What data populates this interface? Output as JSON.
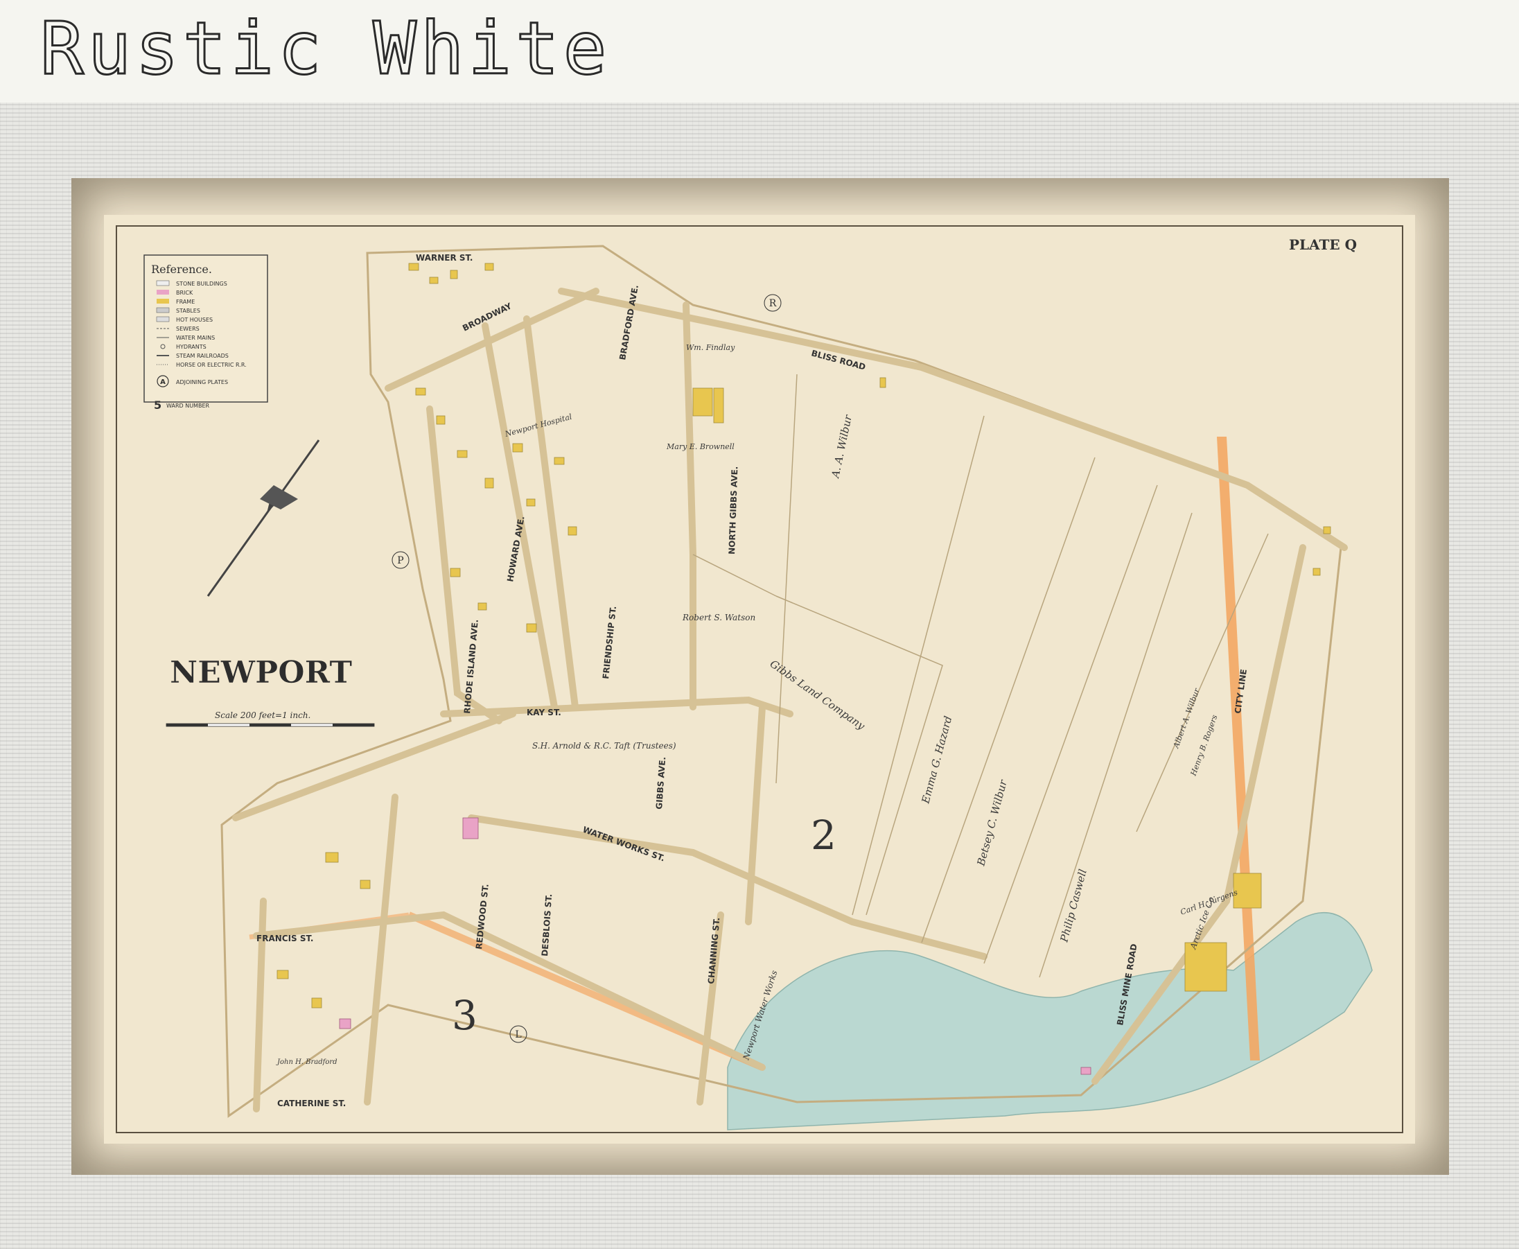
{
  "page": {
    "title": "Rustic White"
  },
  "map": {
    "plate_label": "PLATE Q",
    "city_label": "NEWPORT",
    "scale_text": "Scale 200 feet=1 inch.",
    "reference": {
      "title": "Reference.",
      "items": [
        "STONE BUILDINGS",
        "BRICK",
        "FRAME",
        "STABLES",
        "HOT HOUSES",
        "SEWERS",
        "WATER MAINS",
        "HYDRANTS",
        "STEAM RAILROADS",
        "HORSE OR ELECTRIC R.R.",
        "ADJOINING PLATES",
        "WARD NUMBER"
      ],
      "ward_sample": "5",
      "plate_sample": "A"
    },
    "streets": [
      "BROADWAY",
      "WARNER ST.",
      "BLISS ROAD",
      "BRADFORD AVE.",
      "NORTH GIBBS AVE.",
      "KAY ST.",
      "RHODE ISLAND AVE.",
      "HOWARD AVE.",
      "FRIENDSHIP ST.",
      "WATER WORKS ST.",
      "GIBBS AVE.",
      "FRANCIS ST.",
      "REDWOOD ST.",
      "DESBLOIS ST.",
      "CHANNING ST.",
      "CATHERINE ST.",
      "BLISS MINE ROAD",
      "CITY LINE"
    ],
    "adjoining_plates": [
      "R",
      "P",
      "L"
    ],
    "ward_numbers": [
      "2",
      "3"
    ],
    "owners": [
      "A. A. Wilbur",
      "Emma G. Hazard",
      "Betsey C. Wilbur",
      "Gibbs Land Company",
      "Robert S. Watson",
      "S.H. Arnold & R.C. Taft (Trustees)",
      "Philip Caswell",
      "Newport Water Works",
      "Newport Hospital",
      "John H. Bradford",
      "Arctic Ice Co.",
      "Carl H. Jurgens",
      "Mary E. Brownell",
      "Wm. Findlay",
      "Albert A. Wilbur",
      "Henry B. Rogers"
    ]
  },
  "colors": {
    "paper": "#f0e6cc",
    "road": "#d9c49a",
    "water": "#b9d8d2",
    "brick": "#e9a2c4",
    "frame_bldg": "#e6c24e",
    "railroad": "#f0a060"
  }
}
